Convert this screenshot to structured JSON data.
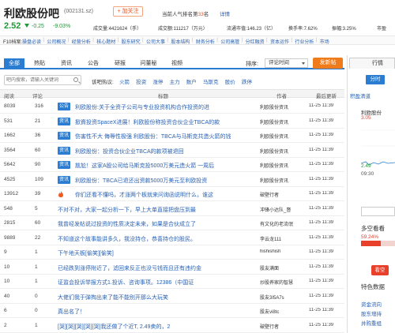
{
  "header": {
    "stock_name": "利欧股份吧",
    "stock_code": "(002131.sz)",
    "follow_label": "+ 加关注",
    "rank_prefix": "当前人气排名第",
    "rank_num": "33",
    "rank_suffix": "名",
    "rank_detail": "详情"
  },
  "quote": {
    "price": "2.52",
    "change": "-0.25",
    "change_pct": "-9.03%",
    "stats": [
      {
        "label": "成交量:",
        "value": "4421624（手）"
      },
      {
        "label": "成交额:",
        "value": "111217（万元）"
      },
      {
        "label": "流通市值:",
        "value": "146.23（亿）"
      },
      {
        "label": "换手率:",
        "value": "7.62%"
      },
      {
        "label": "振幅:",
        "value": "3.25%"
      },
      {
        "label": "市盈",
        "value": ""
      }
    ]
  },
  "f10": {
    "label": "F10档案:",
    "links": [
      "操盘必读",
      "公司概况",
      "经营分析",
      "核心题材",
      "股东研究",
      "公司大事",
      "股本结构",
      "财务分析",
      "公司高管",
      "分红融资",
      "资本运作",
      "行业分析",
      "市场"
    ]
  },
  "tabs": [
    "全部",
    "热贴",
    "资讯",
    "公告",
    "研报",
    "问董秘",
    "视频"
  ],
  "sort": {
    "label": "排序:",
    "value": "评论时间"
  },
  "post_button": "发新帖",
  "search": {
    "placeholder": "吧内搜索，请输入关键词"
  },
  "keywords": {
    "label": "该吧热议:",
    "items": [
      "火箭",
      "投资",
      "涨停",
      "主力",
      "数户",
      "马斯克",
      "股价",
      "跌停"
    ]
  },
  "table": {
    "headers": [
      "阅读",
      "评论",
      "标题",
      "作者",
      "最后更新"
    ],
    "rows": [
      {
        "reads": "8039",
        "comments": "316",
        "badge": "公告",
        "title": "利欧股份:关于全资子公司与专业投资机构合作投资的进",
        "author": "利欧股份资讯",
        "time": "11-25 11:39"
      },
      {
        "reads": "531",
        "comments": "21",
        "badge": "资讯",
        "title": "掀資投资SpaceX进展！利欧股份称投资合伙企业TBCA的款",
        "author": "利欧股份资讯",
        "time": "11-25 11:39"
      },
      {
        "reads": "1662",
        "comments": "36",
        "badge": "资讯",
        "title": "伤害性不大 侮辱性极强 利欧股份：TBCA与马斯克共造火箭的钱",
        "author": "利欧股份资讯",
        "time": "11-25 11:39"
      },
      {
        "reads": "3564",
        "comments": "60",
        "badge": "资讯",
        "title": "利欧股份：投资合伙企业TBCA的款项被退回",
        "author": "利欧股份资讯",
        "time": "11-25 11:39"
      },
      {
        "reads": "5642",
        "comments": "90",
        "badge": "资讯",
        "title": "尴尬！这家A股公司给马斯克投5000万美元造火箭 一周后",
        "author": "利欧股份资讯",
        "time": "11-25 11:39"
      },
      {
        "reads": "4525",
        "comments": "109",
        "badge": "资讯",
        "title": "利欧股份：TBCA已退还出资款5000万美元至利欧投资",
        "author": "利欧股份资讯",
        "time": "11-25 11:39"
      },
      {
        "reads": "13912",
        "comments": "39",
        "badge": "",
        "hot": true,
        "title": "你们还看不懂吗，才涨两个板就来问询函说明什么，谁这",
        "author": "破壁行者",
        "time": "11-25 11:39"
      },
      {
        "reads": "548",
        "comments": "5",
        "badge": "",
        "title": "不对不对，大家一起分析一下，早上大单直接把盘压到最",
        "author": "冲锋小达队_督",
        "time": "11-25 11:39"
      },
      {
        "reads": "2815",
        "comments": "60",
        "badge": "",
        "title": "我曾经发帖说过投资的性质决定未来，如果是合伙成立了",
        "author": "有文化的老流氓",
        "time": "11-25 11:39"
      },
      {
        "reads": "9889",
        "comments": "22",
        "badge": "",
        "title": "不知道这个故事能讲多久，我没持仓，恭喜持仓的股民。",
        "author": "李云龙111",
        "time": "11-25 11:39"
      },
      {
        "reads": "9",
        "comments": "1",
        "badge": "",
        "title": "下午地天板[偷笑][偷笑]",
        "author": "hishishish",
        "time": "11-25 11:39"
      },
      {
        "reads": "10",
        "comments": "1",
        "badge": "",
        "title": "已经跌到涨停附近了，滤回来反正也没亏钱而且还有违约金",
        "author": "股友满面",
        "time": "11-25 11:39"
      },
      {
        "reads": "10",
        "comments": "1",
        "badge": "",
        "title": "证监会投诉举报方式1.投诉、咨询事项。12386（中国证",
        "author": "炒股养家的智慧",
        "time": "11-25 11:39"
      },
      {
        "reads": "40",
        "comments": "0",
        "badge": "",
        "title": "大佬们我于弹掏出来了能不能别开那么大玩笑",
        "author": "股友3I5A7s",
        "time": "11-25 11:39"
      },
      {
        "reads": "6",
        "comments": "0",
        "badge": "",
        "title": "真出名了！",
        "author": "股友vi8tc",
        "time": "11-25 11:39"
      },
      {
        "reads": "2",
        "comments": "1",
        "badge": "",
        "title": "[哭][哭][哭][哭][哭]我还做了个近T, 2.49卖的，2",
        "author": "破壁行者",
        "time": "11-25 11:39"
      }
    ]
  },
  "right_panel": {
    "tab": "行情",
    "fen_label": "分时",
    "live_text": "积盈清道",
    "fund_label": "利欧股份",
    "val1": "3.05",
    "val2": "2.49",
    "time_label": "09:30",
    "section": "多空看看",
    "pct": "59.24%",
    "btn": "看空",
    "special_label": "特色数据",
    "items": [
      "资金流向",
      "股东增持",
      "并购重组"
    ]
  },
  "colors": {
    "accent": "#2a7dd1",
    "down": "#1f9a35",
    "up": "#e8402a",
    "orange": "#f07b1b"
  }
}
